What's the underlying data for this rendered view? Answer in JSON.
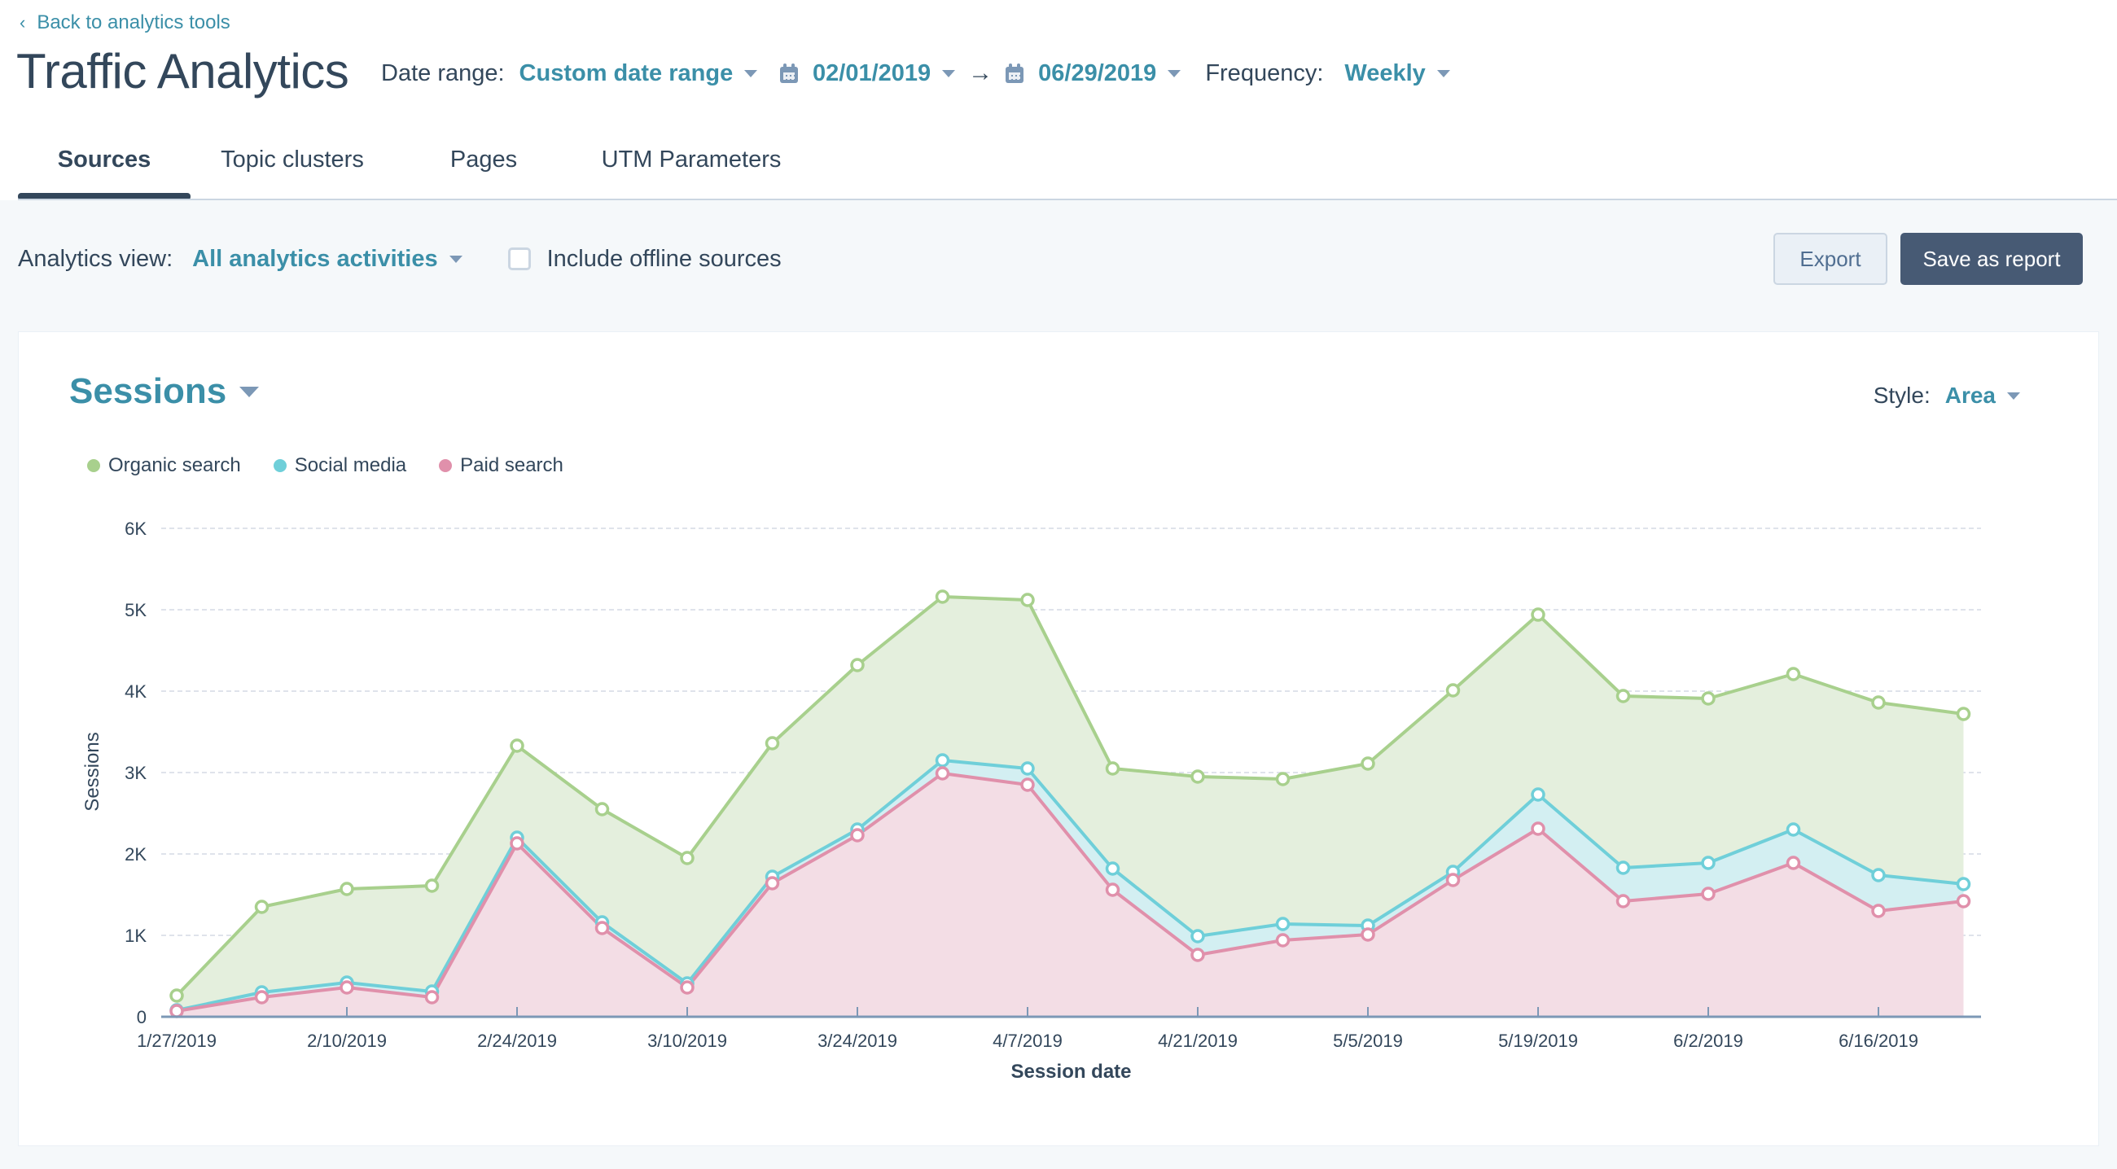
{
  "header": {
    "back_link": "Back to analytics tools",
    "title": "Traffic Analytics",
    "date_range_label": "Date range:",
    "date_range_value": "Custom date range",
    "start_date": "02/01/2019",
    "arrow": "→",
    "end_date": "06/29/2019",
    "frequency_label": "Frequency:",
    "frequency_value": "Weekly"
  },
  "tabs": [
    {
      "label": "Sources",
      "active": true
    },
    {
      "label": "Topic clusters",
      "active": false
    },
    {
      "label": "Pages",
      "active": false
    },
    {
      "label": "UTM Parameters",
      "active": false
    }
  ],
  "toolbar": {
    "analytics_view_label": "Analytics view:",
    "analytics_view_value": "All analytics activities",
    "offline_checkbox_label": "Include offline sources",
    "offline_checked": false,
    "export_label": "Export",
    "save_label": "Save as report"
  },
  "card": {
    "metric": "Sessions",
    "style_label": "Style:",
    "style_value": "Area"
  },
  "colors": {
    "accent": "#3b8fa8",
    "organic": "#a8d08d",
    "social": "#6fcfd9",
    "paid": "#e090ab",
    "organic_fill": "#e4efdd",
    "social_fill": "#d3eff2",
    "paid_fill": "#f3dde5"
  },
  "chart_data": {
    "type": "area",
    "stacked": true,
    "title": "Sessions",
    "xlabel": "Session date",
    "ylabel": "Sessions",
    "ylim": [
      0,
      6000
    ],
    "yticks": [
      0,
      1000,
      2000,
      3000,
      4000,
      5000,
      6000
    ],
    "ytick_labels": [
      "0",
      "1K",
      "2K",
      "3K",
      "4K",
      "5K",
      "6K"
    ],
    "grid": true,
    "legend_position": "top-left",
    "x": [
      "1/27/2019",
      "2/3/2019",
      "2/10/2019",
      "2/17/2019",
      "2/24/2019",
      "3/3/2019",
      "3/10/2019",
      "3/17/2019",
      "3/24/2019",
      "3/31/2019",
      "4/7/2019",
      "4/14/2019",
      "4/21/2019",
      "4/28/2019",
      "5/5/2019",
      "5/12/2019",
      "5/19/2019",
      "5/26/2019",
      "6/2/2019",
      "6/9/2019",
      "6/16/2019",
      "6/23/2019"
    ],
    "xtick_labels": [
      "1/27/2019",
      "2/10/2019",
      "2/24/2019",
      "3/10/2019",
      "3/24/2019",
      "4/7/2019",
      "4/21/2019",
      "5/5/2019",
      "5/19/2019",
      "6/2/2019",
      "6/16/2019"
    ],
    "series": [
      {
        "name": "Paid search",
        "values": [
          70,
          240,
          360,
          240,
          2130,
          1090,
          360,
          1640,
          2230,
          2990,
          2850,
          1560,
          760,
          940,
          1010,
          1680,
          2310,
          1420,
          1510,
          1890,
          1300,
          1420
        ]
      },
      {
        "name": "Social media",
        "values": [
          10,
          60,
          60,
          70,
          70,
          70,
          50,
          80,
          70,
          160,
          200,
          260,
          230,
          200,
          110,
          100,
          420,
          410,
          380,
          410,
          440,
          210
        ]
      },
      {
        "name": "Organic search",
        "values": [
          180,
          1050,
          1150,
          1300,
          1130,
          1390,
          1540,
          1640,
          2020,
          2010,
          2070,
          1230,
          1960,
          1780,
          1990,
          2230,
          2210,
          2110,
          2020,
          1910,
          2120,
          2090
        ]
      }
    ],
    "legend": [
      "Organic search",
      "Social media",
      "Paid search"
    ]
  }
}
